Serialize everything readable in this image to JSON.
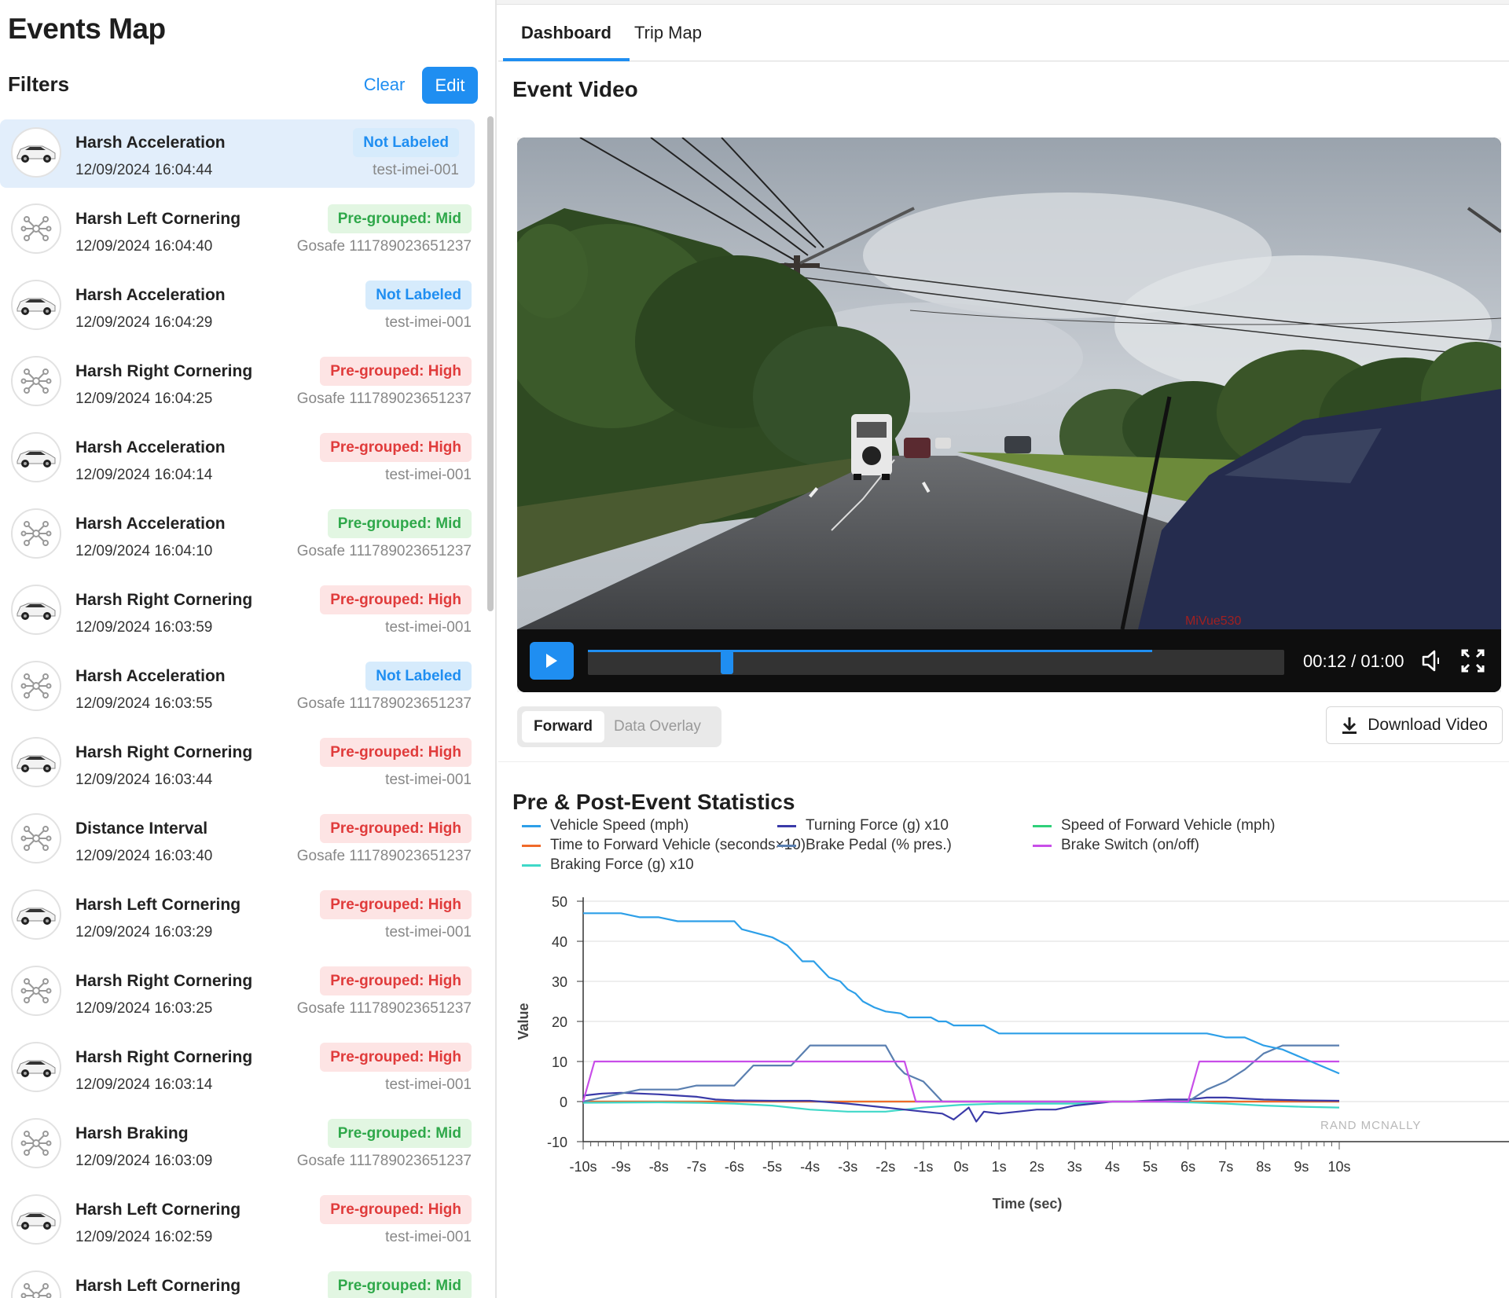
{
  "app": {
    "title": "Events Map",
    "filters_label": "Filters",
    "clear_label": "Clear",
    "edit_label": "Edit"
  },
  "events": [
    {
      "title": "Harsh Acceleration",
      "time": "12/09/2024 16:04:44",
      "badge": "Not Labeled",
      "badge_color": "blue",
      "device": "test-imei-001",
      "icon": "car-icon",
      "selected": true
    },
    {
      "title": "Harsh Left Cornering",
      "time": "12/09/2024 16:04:40",
      "badge": "Pre-grouped: Mid",
      "badge_color": "green",
      "device": "Gosafe 111789023651237",
      "icon": "network-icon",
      "selected": false
    },
    {
      "title": "Harsh Acceleration",
      "time": "12/09/2024 16:04:29",
      "badge": "Not Labeled",
      "badge_color": "blue",
      "device": "test-imei-001",
      "icon": "car-icon",
      "selected": false
    },
    {
      "title": "Harsh Right Cornering",
      "time": "12/09/2024 16:04:25",
      "badge": "Pre-grouped: High",
      "badge_color": "red",
      "device": "Gosafe 111789023651237",
      "icon": "network-icon",
      "selected": false
    },
    {
      "title": "Harsh Acceleration",
      "time": "12/09/2024 16:04:14",
      "badge": "Pre-grouped: High",
      "badge_color": "red",
      "device": "test-imei-001",
      "icon": "car-icon",
      "selected": false
    },
    {
      "title": "Harsh Acceleration",
      "time": "12/09/2024 16:04:10",
      "badge": "Pre-grouped: Mid",
      "badge_color": "green",
      "device": "Gosafe 111789023651237",
      "icon": "network-icon",
      "selected": false
    },
    {
      "title": "Harsh Right Cornering",
      "time": "12/09/2024 16:03:59",
      "badge": "Pre-grouped: High",
      "badge_color": "red",
      "device": "test-imei-001",
      "icon": "car-icon",
      "selected": false
    },
    {
      "title": "Harsh Acceleration",
      "time": "12/09/2024 16:03:55",
      "badge": "Not Labeled",
      "badge_color": "blue",
      "device": "Gosafe 111789023651237",
      "icon": "network-icon",
      "selected": false
    },
    {
      "title": "Harsh Right Cornering",
      "time": "12/09/2024 16:03:44",
      "badge": "Pre-grouped: High",
      "badge_color": "red",
      "device": "test-imei-001",
      "icon": "car-icon",
      "selected": false
    },
    {
      "title": "Distance Interval",
      "time": "12/09/2024 16:03:40",
      "badge": "Pre-grouped: High",
      "badge_color": "red",
      "device": "Gosafe 111789023651237",
      "icon": "network-icon",
      "selected": false
    },
    {
      "title": "Harsh Left Cornering",
      "time": "12/09/2024 16:03:29",
      "badge": "Pre-grouped: High",
      "badge_color": "red",
      "device": "test-imei-001",
      "icon": "car-icon",
      "selected": false
    },
    {
      "title": "Harsh Right Cornering",
      "time": "12/09/2024 16:03:25",
      "badge": "Pre-grouped: High",
      "badge_color": "red",
      "device": "Gosafe 111789023651237",
      "icon": "network-icon",
      "selected": false
    },
    {
      "title": "Harsh Right Cornering",
      "time": "12/09/2024 16:03:14",
      "badge": "Pre-grouped: High",
      "badge_color": "red",
      "device": "test-imei-001",
      "icon": "car-icon",
      "selected": false
    },
    {
      "title": "Harsh Braking",
      "time": "12/09/2024 16:03:09",
      "badge": "Pre-grouped: Mid",
      "badge_color": "green",
      "device": "Gosafe 111789023651237",
      "icon": "network-icon",
      "selected": false
    },
    {
      "title": "Harsh Left Cornering",
      "time": "12/09/2024 16:02:59",
      "badge": "Pre-grouped: High",
      "badge_color": "red",
      "device": "test-imei-001",
      "icon": "car-icon",
      "selected": false
    },
    {
      "title": "Harsh Left Cornering",
      "time": "",
      "badge": "Pre-grouped: Mid",
      "badge_color": "green",
      "device": "",
      "icon": "network-icon",
      "selected": false
    }
  ],
  "tabs": {
    "dashboard": "Dashboard",
    "trip_map": "Trip Map"
  },
  "video": {
    "section_title": "Event Video",
    "time_readout": "00:12 / 01:00",
    "current_seconds": 12,
    "duration_seconds": 60,
    "buffered_fraction": 0.81,
    "view_forward": "Forward",
    "view_overlay": "Data Overlay",
    "download_label": "Download Video",
    "camera_watermark": "MiVue530"
  },
  "stats": {
    "section_title": "Pre & Post-Event Statistics",
    "watermark": "RAND MCNALLY"
  },
  "colors": {
    "accent": "#1f8ef1",
    "badge_blue_bg": "#d6ebfc",
    "badge_green_bg": "#e2f6e2",
    "badge_red_bg": "#fde4e4"
  },
  "chart_data": {
    "type": "line",
    "xlabel": "Time (sec)",
    "ylabel": "Value",
    "ylim": [
      -10,
      50
    ],
    "yticks": [
      -10,
      0,
      10,
      20,
      30,
      40,
      50
    ],
    "xticks": [
      "-10s",
      "-9s",
      "-8s",
      "-7s",
      "-6s",
      "-5s",
      "-4s",
      "-3s",
      "-2s",
      "-1s",
      "0s",
      "1s",
      "2s",
      "3s",
      "4s",
      "5s",
      "6s",
      "7s",
      "8s",
      "9s",
      "10s"
    ],
    "xlim": [
      -10,
      10
    ],
    "grid": true,
    "legend_position": "top",
    "series": [
      {
        "name": "Vehicle Speed (mph)",
        "color": "#2d9fe8",
        "points": [
          [
            -10,
            47
          ],
          [
            -9,
            47
          ],
          [
            -8.5,
            46
          ],
          [
            -8,
            46
          ],
          [
            -7.5,
            45
          ],
          [
            -6,
            45
          ],
          [
            -5.8,
            43
          ],
          [
            -5.4,
            42
          ],
          [
            -5,
            41
          ],
          [
            -4.6,
            39
          ],
          [
            -4.4,
            37
          ],
          [
            -4.2,
            35
          ],
          [
            -3.9,
            35
          ],
          [
            -3.7,
            33
          ],
          [
            -3.5,
            31
          ],
          [
            -3.2,
            30
          ],
          [
            -3,
            28
          ],
          [
            -2.8,
            27
          ],
          [
            -2.6,
            25
          ],
          [
            -2.3,
            23.5
          ],
          [
            -2,
            22.5
          ],
          [
            -1.6,
            22
          ],
          [
            -1.4,
            21
          ],
          [
            -0.8,
            21
          ],
          [
            -0.6,
            20
          ],
          [
            -0.4,
            20
          ],
          [
            -0.2,
            19
          ],
          [
            0.6,
            19
          ],
          [
            1.0,
            17
          ],
          [
            6,
            17
          ],
          [
            6.5,
            17
          ],
          [
            7,
            16
          ],
          [
            7.5,
            16
          ],
          [
            8,
            14
          ],
          [
            8.5,
            13
          ],
          [
            9,
            11
          ],
          [
            9.5,
            9
          ],
          [
            10,
            7
          ]
        ]
      },
      {
        "name": "Turning Force (g) x10",
        "color": "#3a3aa8",
        "points": [
          [
            -10,
            1.5
          ],
          [
            -9.5,
            2
          ],
          [
            -9,
            2.2
          ],
          [
            -8.5,
            2
          ],
          [
            -8,
            1.8
          ],
          [
            -7.5,
            1.5
          ],
          [
            -7,
            1.2
          ],
          [
            -6.5,
            0.5
          ],
          [
            -6,
            0.3
          ],
          [
            -5,
            0.2
          ],
          [
            -4,
            0.2
          ],
          [
            -3,
            -0.5
          ],
          [
            -2.5,
            -1
          ],
          [
            -2,
            -1.5
          ],
          [
            -1.5,
            -2
          ],
          [
            -1,
            -2.5
          ],
          [
            -0.5,
            -3
          ],
          [
            -0.2,
            -4.5
          ],
          [
            0,
            -3
          ],
          [
            0.2,
            -1.5
          ],
          [
            0.4,
            -5
          ],
          [
            0.6,
            -2.5
          ],
          [
            1,
            -3
          ],
          [
            1.5,
            -2.5
          ],
          [
            2,
            -2
          ],
          [
            2.5,
            -2
          ],
          [
            3,
            -1
          ],
          [
            3.5,
            -0.5
          ],
          [
            4,
            0
          ],
          [
            4.5,
            0
          ],
          [
            5,
            0.3
          ],
          [
            5.5,
            0.5
          ],
          [
            6,
            0.5
          ],
          [
            6.5,
            1
          ],
          [
            7,
            1
          ],
          [
            8,
            0.5
          ],
          [
            9,
            0.3
          ],
          [
            10,
            0.2
          ]
        ]
      },
      {
        "name": "Speed of Forward Vehicle (mph)",
        "color": "#2fd07a",
        "points": [
          [
            -10,
            0
          ],
          [
            10,
            0
          ]
        ]
      },
      {
        "name": "Time to Forward Vehicle (seconds×10)",
        "color": "#f06a2a",
        "points": [
          [
            -10,
            0
          ],
          [
            10,
            0
          ]
        ]
      },
      {
        "name": "Brake Pedal (% pres.)",
        "color": "#5a7fb0",
        "points": [
          [
            -10,
            0
          ],
          [
            -8.5,
            3
          ],
          [
            -7.5,
            3
          ],
          [
            -7,
            4
          ],
          [
            -6,
            4
          ],
          [
            -5.5,
            9
          ],
          [
            -4.5,
            9
          ],
          [
            -4,
            14
          ],
          [
            -2,
            14
          ],
          [
            -1.7,
            9
          ],
          [
            -1.5,
            7
          ],
          [
            -1,
            5
          ],
          [
            -0.5,
            0
          ],
          [
            6,
            0
          ],
          [
            6.5,
            3
          ],
          [
            7,
            5
          ],
          [
            7.5,
            8
          ],
          [
            8,
            12
          ],
          [
            8.5,
            14
          ],
          [
            10,
            14
          ]
        ]
      },
      {
        "name": "Brake Switch (on/off)",
        "color": "#c84ee8",
        "points": [
          [
            -10,
            0
          ],
          [
            -9.7,
            10
          ],
          [
            -1.5,
            10
          ],
          [
            -1.2,
            0
          ],
          [
            6,
            0
          ],
          [
            6.3,
            10
          ],
          [
            10,
            10
          ]
        ]
      },
      {
        "name": "Braking Force (g) x10",
        "color": "#3fd8c8",
        "points": [
          [
            -10,
            -0.3
          ],
          [
            -8,
            -0.2
          ],
          [
            -7,
            -0.3
          ],
          [
            -6,
            -0.5
          ],
          [
            -5,
            -1
          ],
          [
            -4,
            -2
          ],
          [
            -3,
            -2.5
          ],
          [
            -2,
            -2.5
          ],
          [
            -1,
            -1.5
          ],
          [
            0,
            -0.8
          ],
          [
            1,
            -0.5
          ],
          [
            2,
            -0.5
          ],
          [
            3,
            -0.5
          ],
          [
            4,
            0
          ],
          [
            5,
            0
          ],
          [
            6,
            -0.2
          ],
          [
            7,
            -0.5
          ],
          [
            8,
            -1
          ],
          [
            9,
            -1.3
          ],
          [
            10,
            -1.5
          ]
        ]
      }
    ]
  }
}
